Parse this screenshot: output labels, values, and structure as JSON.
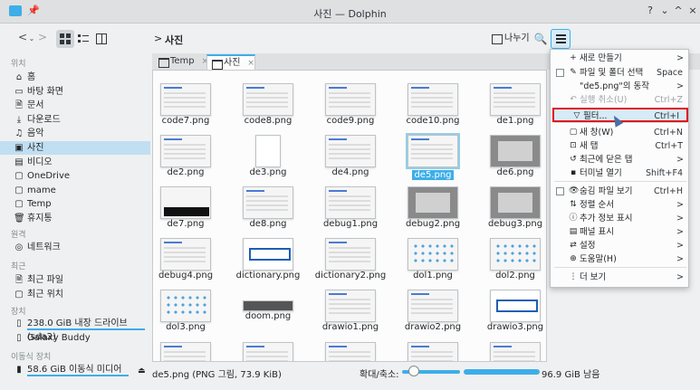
{
  "window": {
    "title": "사진 — Dolphin"
  },
  "titlebar": {
    "pin": "📌",
    "help": "?",
    "shade": "⌄",
    "maximize": "^",
    "close": "×"
  },
  "toolbar": {
    "back": "<",
    "back_more": "⌄",
    "forward": ">",
    "breadcrumb_arrow": ">",
    "breadcrumb": "사진",
    "split_label": "나누기",
    "search": "🔍"
  },
  "sidebar": {
    "sections": {
      "places": "위치",
      "remote": "원격",
      "recent": "최근",
      "devices": "장치",
      "removable": "이동식 장치"
    },
    "places": [
      {
        "label": "홈",
        "icon": "⌂"
      },
      {
        "label": "바탕 화면",
        "icon": "▭"
      },
      {
        "label": "문서",
        "icon": "🗎"
      },
      {
        "label": "다운로드",
        "icon": "⤓"
      },
      {
        "label": "음악",
        "icon": "♫"
      },
      {
        "label": "사진",
        "icon": "▣"
      },
      {
        "label": "비디오",
        "icon": "▤"
      },
      {
        "label": "OneDrive",
        "icon": "▢"
      },
      {
        "label": "mame",
        "icon": "▢"
      },
      {
        "label": "Temp",
        "icon": "▢"
      },
      {
        "label": "휴지통",
        "icon": "🗑"
      }
    ],
    "remote": [
      {
        "label": "네트워크",
        "icon": "◎"
      }
    ],
    "recent": [
      {
        "label": "최근 파일",
        "icon": "🗎"
      },
      {
        "label": "최근 위치",
        "icon": "▢"
      }
    ],
    "devices": [
      {
        "label": "238.0 GiB 내장 드라이브(sda2)",
        "icon": "▯"
      },
      {
        "label": "Galaxy Buddy",
        "icon": "▯"
      }
    ],
    "removable": [
      {
        "label": "58.6 GiB 이동식 미디어",
        "icon": "▮"
      }
    ],
    "eject": "⏏"
  },
  "tabs": [
    {
      "label": "Temp",
      "close": "×"
    },
    {
      "label": "사진",
      "close": "×"
    }
  ],
  "files": [
    "code7.png",
    "code8.png",
    "code9.png",
    "code10.png",
    "de1.png",
    "de2.png",
    "de3.png",
    "de4.png",
    "de5.png",
    "de6.png",
    "de7.png",
    "de8.png",
    "debug1.png",
    "debug2.png",
    "debug3.png",
    "debug4.png",
    "dictionary.png",
    "dictionary2.png",
    "dol1.png",
    "dol2.png",
    "dol3.png",
    "doom.png",
    "drawio1.png",
    "drawio2.png",
    "drawio3.png"
  ],
  "status": {
    "text": "de5.png (PNG 그림, 73.9 KiB)",
    "zoom_label": "확대/축소:",
    "zoom_level": 0.2,
    "free_space": "96.9 GiB 남음"
  },
  "menu": {
    "items": [
      {
        "icon": "+",
        "label": "새로 만들기",
        "shortcut": "",
        "submenu": ">"
      },
      {
        "icon": "✎",
        "label": "파일 및 폴더 선택",
        "shortcut": "Space",
        "submenu": ""
      },
      {
        "icon": "",
        "label": "\"de5.png\"의 동작",
        "shortcut": "",
        "submenu": ">"
      },
      {
        "icon": "↶",
        "label": "실행 취소(U)",
        "shortcut": "Ctrl+Z",
        "submenu": ""
      },
      {
        "icon": "▽",
        "label": "필터...",
        "shortcut": "Ctrl+I",
        "submenu": ""
      },
      {
        "icon": "▢",
        "label": "새 창(W)",
        "shortcut": "Ctrl+N",
        "submenu": ""
      },
      {
        "icon": "⊡",
        "label": "새 탭",
        "shortcut": "Ctrl+T",
        "submenu": ""
      },
      {
        "icon": "↺",
        "label": "최근에 닫은 탭",
        "shortcut": "",
        "submenu": ">"
      },
      {
        "icon": "▪",
        "label": "터미널 열기",
        "shortcut": "Shift+F4",
        "submenu": ""
      },
      {
        "icon": "👁",
        "label": "숨김 파일 보기",
        "shortcut": "Ctrl+H",
        "submenu": ""
      },
      {
        "icon": "⇅",
        "label": "정렬 순서",
        "shortcut": "",
        "submenu": ">"
      },
      {
        "icon": "ⓘ",
        "label": "추가 정보 표시",
        "shortcut": "",
        "submenu": ">"
      },
      {
        "icon": "▤",
        "label": "패널 표시",
        "shortcut": "",
        "submenu": ">"
      },
      {
        "icon": "⇄",
        "label": "설정",
        "shortcut": "",
        "submenu": ">"
      },
      {
        "icon": "⊕",
        "label": "도움말(H)",
        "shortcut": "",
        "submenu": ">"
      },
      {
        "icon": "⋮",
        "label": "더 보기",
        "shortcut": "",
        "submenu": ">"
      }
    ]
  },
  "colors": {
    "accent": "#3daee9",
    "highlight": "#e0101e",
    "selection": "#c1dff2"
  }
}
